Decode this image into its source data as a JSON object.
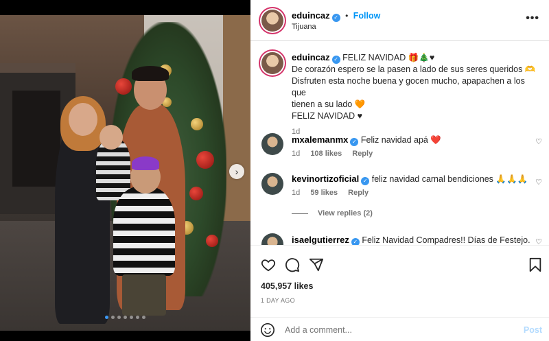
{
  "post": {
    "author": "eduincaz",
    "location": "Tijuana",
    "follow_label": "Follow",
    "more_label": "•••",
    "caption_title": "FELIZ NAVIDAD 🎁🎄♥",
    "caption_line1": "De corazón espero se la pasen a lado de sus seres queridos 🫶",
    "caption_line2": "Disfruten esta noche buena y gocen mucho, apapachen a los que",
    "caption_line3": "tienen a su lado 🧡",
    "caption_line4": "FELIZ NAVIDAD ♥",
    "caption_age": "1d"
  },
  "comments": [
    {
      "user": "mxalemanmx",
      "text": "Feliz navidad apá ❤️",
      "age": "1d",
      "likes": "108 likes",
      "reply": "Reply"
    },
    {
      "user": "kevinortizoficial",
      "text": "feliz navidad carnal bendiciones 🙏🙏🙏",
      "age": "1d",
      "likes": "59 likes",
      "reply": "Reply",
      "view_replies": "View replies (2)"
    },
    {
      "user": "isaelgutierrez",
      "text": "Feliz Navidad Compadres!! Días de Festejo."
    }
  ],
  "likes_count": "405,957 likes",
  "post_time": "1 DAY AGO",
  "add_comment": {
    "placeholder": "Add a comment...",
    "post_label": "Post"
  },
  "carousel": {
    "dot_count": 7,
    "active_index": 0
  },
  "colors": {
    "accent": "#0095f6",
    "verified": "#3897f0",
    "heart": "#ed4956"
  },
  "icons": [
    "more-icon",
    "heart-icon",
    "comment-icon",
    "share-icon",
    "bookmark-icon",
    "emoji-icon",
    "chevron-right-icon",
    "verified-icon"
  ]
}
